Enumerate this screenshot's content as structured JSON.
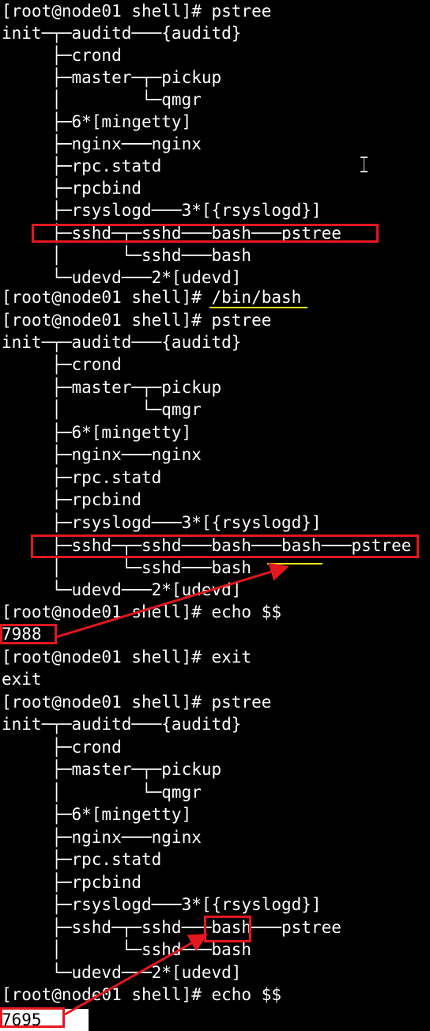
{
  "terminal": {
    "lines": [
      "[root@node01 shell]# pstree",
      "init─┬─auditd───{auditd}",
      "     ├─crond",
      "     ├─master─┬─pickup",
      "     │        └─qmgr",
      "     ├─6*[mingetty]",
      "     ├─nginx───nginx",
      "     ├─rpc.statd",
      "     ├─rpcbind",
      "     ├─rsyslogd───3*[{rsyslogd}]",
      "     ├─sshd─┬─sshd───bash───pstree",
      "     │      └─sshd───bash",
      "     └─udevd───2*[udevd]",
      "[root@node01 shell]# /bin/bash",
      "[root@node01 shell]# pstree",
      "init─┬─auditd───{auditd}",
      "     ├─crond",
      "     ├─master─┬─pickup",
      "     │        └─qmgr",
      "     ├─6*[mingetty]",
      "     ├─nginx───nginx",
      "     ├─rpc.statd",
      "     ├─rpcbind",
      "     ├─rsyslogd───3*[{rsyslogd}]",
      "     ├─sshd─┬─sshd───bash───bash───pstree",
      "     │      └─sshd───bash",
      "     └─udevd───2*[udevd]",
      "[root@node01 shell]# echo $$",
      "7988",
      "[root@node01 shell]# exit",
      "exit",
      "[root@node01 shell]# pstree",
      "init─┬─auditd───{auditd}",
      "     ├─crond",
      "     ├─master─┬─pickup",
      "     │        └─qmgr",
      "     ├─6*[mingetty]",
      "     ├─nginx───nginx",
      "     ├─rpc.statd",
      "     ├─rpcbind",
      "     ├─rsyslogd───3*[{rsyslogd}]",
      "     ├─sshd─┬─sshd───bash───pstree",
      "     │      └─sshd───bash",
      "     └─udevd───2*[udevd]",
      "[root@node01 shell]# echo $$",
      "7695"
    ]
  },
  "colors": {
    "background": "#000000",
    "text": "#ffffff",
    "annotation_red": "#e3171e",
    "annotation_yellow": "#f2e21b"
  },
  "icons": {
    "text_cursor": "i-beam-cursor-icon"
  }
}
